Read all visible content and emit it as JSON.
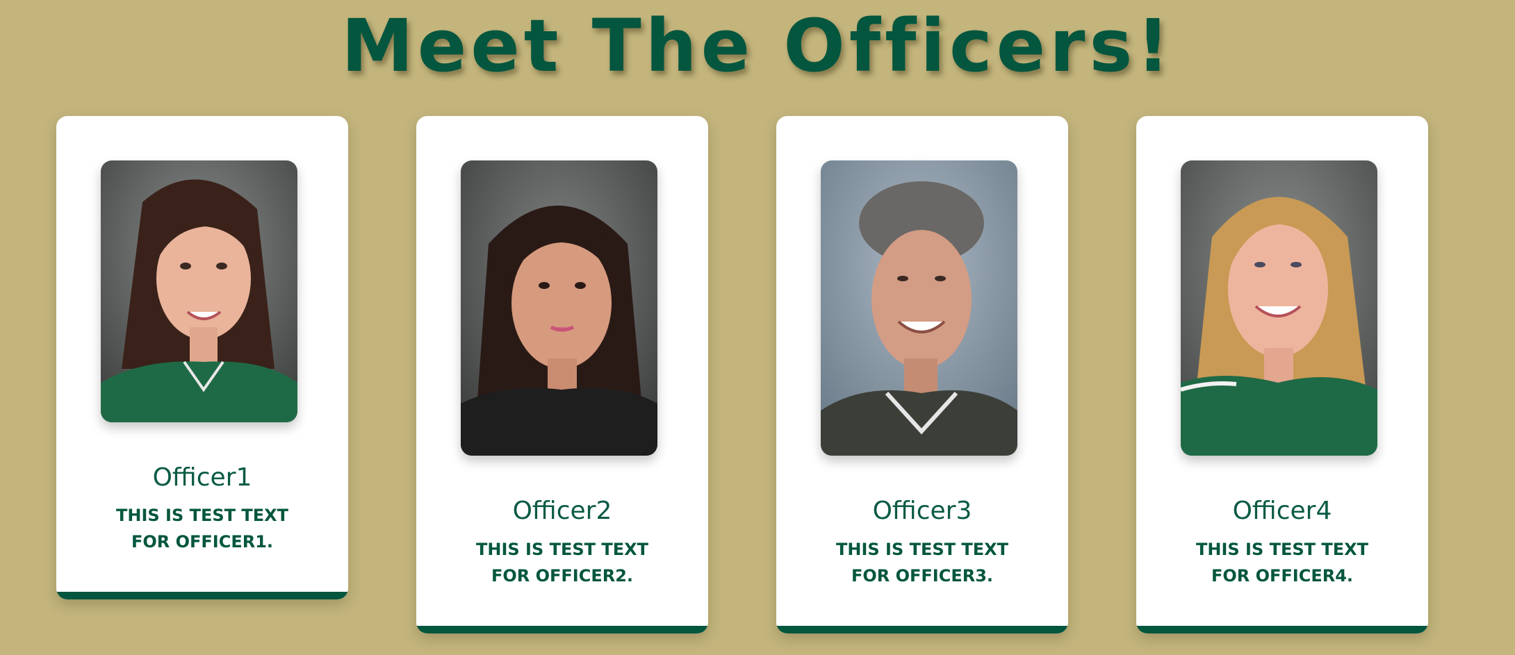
{
  "page": {
    "title": "Meet The Officers!"
  },
  "colors": {
    "background": "#c3b57c",
    "brand_green": "#04563e",
    "card": "#ffffff"
  },
  "officers": [
    {
      "name": "Officer1",
      "desc_line1": "THIS IS TEST TEXT",
      "desc_line2": "FOR OFFICER1.",
      "photo": "portrait-photo"
    },
    {
      "name": "Officer2",
      "desc_line1": "THIS IS TEST TEXT",
      "desc_line2": "FOR OFFICER2.",
      "photo": "portrait-photo"
    },
    {
      "name": "Officer3",
      "desc_line1": "THIS IS TEST TEXT",
      "desc_line2": "FOR OFFICER3.",
      "photo": "portrait-photo"
    },
    {
      "name": "Officer4",
      "desc_line1": "THIS IS TEST TEXT",
      "desc_line2": "FOR OFFICER4.",
      "photo": "portrait-photo"
    }
  ]
}
